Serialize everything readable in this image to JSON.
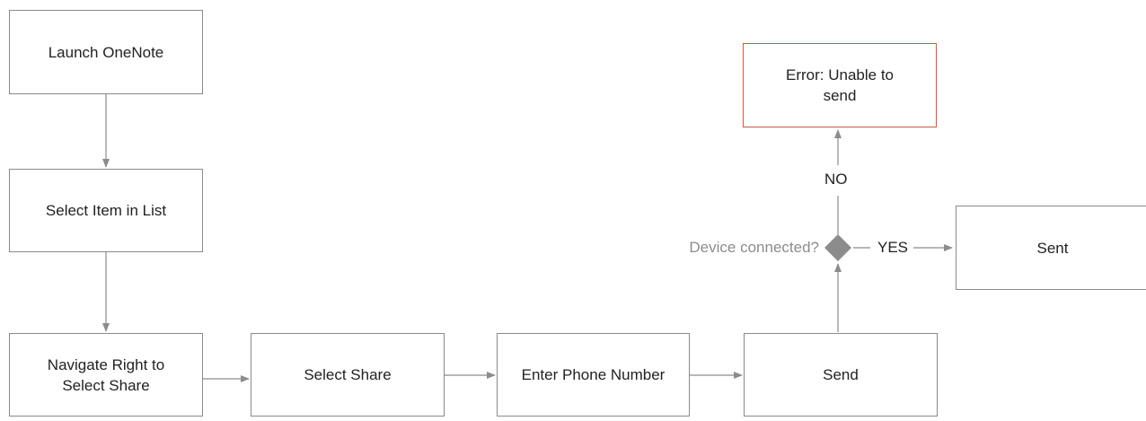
{
  "diagram": {
    "nodes": {
      "launch": "Launch OneNote",
      "select_item": "Select Item in List",
      "navigate": "Navigate Right to\nSelect Share",
      "select_share": "Select Share",
      "enter_phone": "Enter Phone Number",
      "send": "Send",
      "error": "Error: Unable to\nsend",
      "sent": "Sent"
    },
    "decision": {
      "question": "Device connected?",
      "yes_label": "YES",
      "no_label": "NO"
    }
  },
  "colors": {
    "box_border": "#8a8a8a",
    "error_border": "#e0533a",
    "connector": "#8c8c8c",
    "decision_fill": "#8c8c8c",
    "muted_text": "#8c8c8c"
  }
}
